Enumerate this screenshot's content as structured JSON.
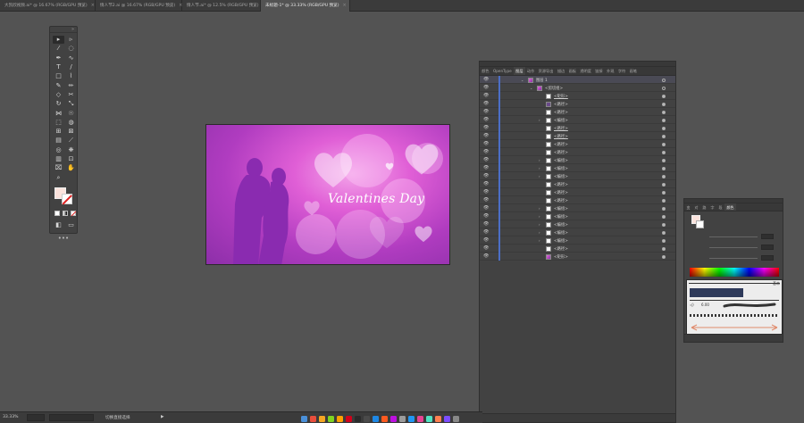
{
  "tabs": [
    {
      "label": "大凯欣视频.ai* @ 16.67% (RGB/GPU 预览)",
      "close": "×",
      "active": false
    },
    {
      "label": "情人节2.ai @ 16.67% (RGB/GPU 预览)",
      "close": "×",
      "active": false
    },
    {
      "label": "情人节.ai* @ 12.5% (RGB/GPU 预览)",
      "close": "×",
      "active": false
    },
    {
      "label": "未标题-1* @ 33.33% (RGB/GPU 预览)",
      "close": "×",
      "active": true
    }
  ],
  "toolbar": {
    "tools": [
      "selection-icon",
      "direct-selection-icon",
      "magic-wand-icon",
      "lasso-icon",
      "pen-icon",
      "curvature-icon",
      "type-icon",
      "line-icon",
      "rectangle-icon",
      "paintbrush-icon",
      "shaper-icon",
      "pencil-icon",
      "eraser-icon",
      "scissors-icon",
      "rotate-icon",
      "scale-icon",
      "width-icon",
      "warp-icon",
      "free-transform-icon",
      "shape-builder-icon",
      "perspective-icon",
      "mesh-icon",
      "gradient-icon",
      "eyedropper-icon",
      "blend-icon",
      "symbol-sprayer-icon",
      "column-graph-icon",
      "artboard-icon",
      "slice-icon",
      "hand-icon",
      "zoom-icon"
    ],
    "more": "•••"
  },
  "artboard": {
    "title": "Valentines Day"
  },
  "layers_panel": {
    "tabs": [
      "颜色",
      "OpenType",
      "图层",
      "动作",
      "资源导出",
      "描边",
      "画板",
      "透明度",
      "链接",
      "外观",
      "字符",
      "画笔"
    ],
    "active_tab": "图层",
    "rows": [
      {
        "name": "图层 1",
        "level": 0,
        "thumb": "pink",
        "arrow": "v"
      },
      {
        "name": "<剪切组>",
        "level": 1,
        "thumb": "pink",
        "arrow": "v"
      },
      {
        "name": "<矩形>",
        "level": 2,
        "thumb": "white",
        "arrow": "",
        "underline": true
      },
      {
        "name": "<路径>",
        "level": 2,
        "thumb": "dark",
        "arrow": ""
      },
      {
        "name": "<路径>",
        "level": 2,
        "thumb": "white",
        "arrow": ""
      },
      {
        "name": "<编组>",
        "level": 2,
        "thumb": "white",
        "arrow": ">"
      },
      {
        "name": "<路径>",
        "level": 2,
        "thumb": "white",
        "arrow": "",
        "underline": true
      },
      {
        "name": "<路径>",
        "level": 2,
        "thumb": "white",
        "arrow": "",
        "underline": true
      },
      {
        "name": "<路径>",
        "level": 2,
        "thumb": "white",
        "arrow": ""
      },
      {
        "name": "<路径>",
        "level": 2,
        "thumb": "white",
        "arrow": ""
      },
      {
        "name": "<编组>",
        "level": 2,
        "thumb": "white",
        "arrow": ">"
      },
      {
        "name": "<编组>",
        "level": 2,
        "thumb": "white",
        "arrow": ">"
      },
      {
        "name": "<编组>",
        "level": 2,
        "thumb": "white",
        "arrow": ">"
      },
      {
        "name": "<路径>",
        "level": 2,
        "thumb": "white",
        "arrow": ""
      },
      {
        "name": "<路径>",
        "level": 2,
        "thumb": "white",
        "arrow": ""
      },
      {
        "name": "<路径>",
        "level": 2,
        "thumb": "white",
        "arrow": ""
      },
      {
        "name": "<编组>",
        "level": 2,
        "thumb": "white",
        "arrow": ">"
      },
      {
        "name": "<编组>",
        "level": 2,
        "thumb": "white",
        "arrow": ">"
      },
      {
        "name": "<编组>",
        "level": 2,
        "thumb": "white",
        "arrow": ">"
      },
      {
        "name": "<编组>",
        "level": 2,
        "thumb": "white",
        "arrow": ">"
      },
      {
        "name": "<编组>",
        "level": 2,
        "thumb": "white",
        "arrow": ">"
      },
      {
        "name": "<路径>",
        "level": 2,
        "thumb": "white",
        "arrow": ""
      },
      {
        "name": "<矩形>",
        "level": 2,
        "thumb": "pink",
        "arrow": ""
      }
    ]
  },
  "color_panel": {
    "tabs": [
      "变",
      "对",
      "路",
      "字",
      "段",
      "颜色"
    ],
    "active_tab": "颜色",
    "brush_label": "基本",
    "brush_size": "6.00"
  },
  "statusbar": {
    "zoom": "33.33%",
    "tool_name": "切换直接选择"
  },
  "colors": {
    "accent": "#4c6fc7",
    "artboard_main": "#e05fd6",
    "artboard_dark": "#8d2fa9"
  }
}
